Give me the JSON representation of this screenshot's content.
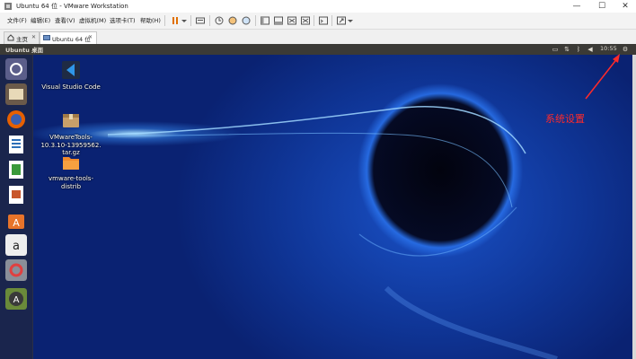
{
  "window": {
    "title": "Ubuntu 64 位 - VMware Workstation",
    "controls": {
      "minimize": "—",
      "maximize": "☐",
      "close": "✕"
    }
  },
  "menubar": {
    "items": [
      "文件(F)",
      "编辑(E)",
      "查看(V)",
      "虚拟机(M)",
      "选项卡(T)",
      "帮助(H)"
    ]
  },
  "tabs": [
    {
      "label": "主页",
      "icon": "home-icon",
      "active": false
    },
    {
      "label": "Ubuntu 64 位",
      "icon": "vm-icon",
      "active": true
    }
  ],
  "ubuntu_panel": {
    "title": "Ubuntu 桌面",
    "clock": "10:55"
  },
  "launcher": {
    "items": [
      "dash-icon",
      "files-icon",
      "firefox-icon",
      "writer-icon",
      "calc-icon",
      "impress-icon",
      "software-center-icon",
      "amazon-icon",
      "system-settings-icon",
      "updater-icon"
    ]
  },
  "desktop_icons": [
    {
      "label": "Visual Studio Code",
      "icon": "vscode-icon"
    },
    {
      "label": "VMwareTools-\n10.3.10-13959562.\ntar.gz",
      "icon": "archive-icon"
    },
    {
      "label": "vmware-tools-\ndistrib",
      "icon": "folder-icon"
    }
  ],
  "annotation": {
    "text": "系统设置",
    "color": "#ff2a2a"
  },
  "colors": {
    "accent_red": "#ff2a2a",
    "panel": "#3b3a36",
    "launcher": "#1e2646"
  }
}
